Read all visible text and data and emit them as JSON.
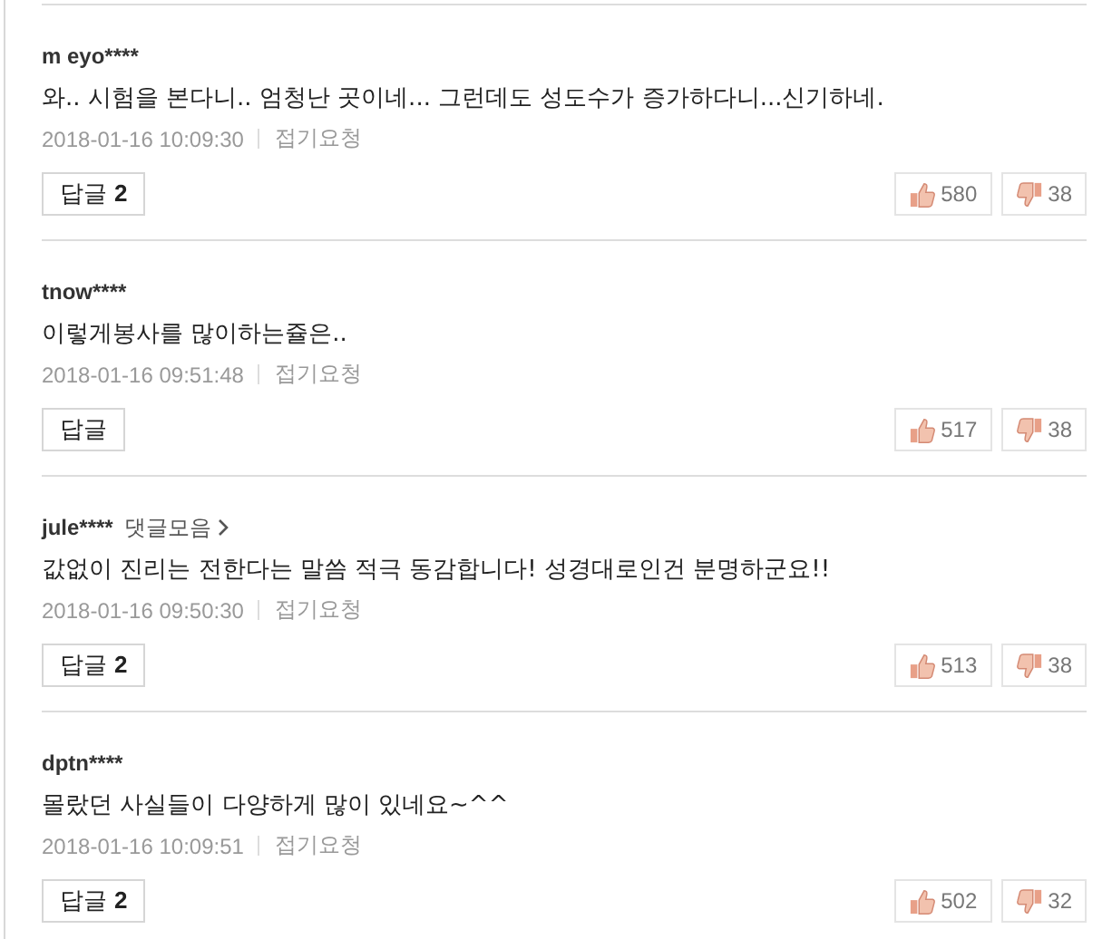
{
  "comments": [
    {
      "user": "m eyo****",
      "text": "와.. 시험을 본다니.. 엄청난 곳이네... 그런데도 성도수가 증가하다니...신기하네.",
      "time": "2018-01-16 10:09:30",
      "fold": "접기요청",
      "reply_label": "답글",
      "reply_count": "2",
      "likes": "580",
      "dislikes": "38"
    },
    {
      "user": "tnow****",
      "text": "이렇게봉사를 많이하는쥴은..",
      "time": "2018-01-16 09:51:48",
      "fold": "접기요청",
      "reply_label": "답글",
      "likes": "517",
      "dislikes": "38"
    },
    {
      "user": "jule****",
      "collection": "댓글모음",
      "text": "값없이 진리는 전한다는 말씀 적극 동감합니다! 성경대로인건 분명하군요!!",
      "time": "2018-01-16 09:50:30",
      "fold": "접기요청",
      "reply_label": "답글",
      "reply_count": "2",
      "likes": "513",
      "dislikes": "38"
    },
    {
      "user": "dptn****",
      "text": "몰랐던 사실들이 다양하게 많이 있네요~^^",
      "time": "2018-01-16 10:09:51",
      "fold": "접기요청",
      "reply_label": "답글",
      "reply_count": "2",
      "likes": "502",
      "dislikes": "32"
    }
  ]
}
